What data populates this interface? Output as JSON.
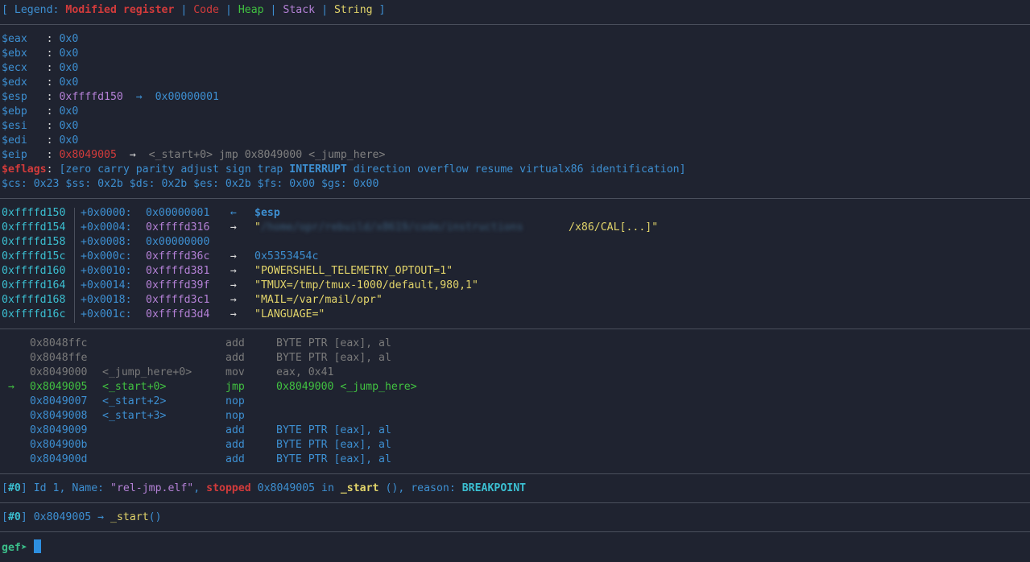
{
  "legend": {
    "open": "[ ",
    "label": "Legend: ",
    "modified": "Modified register",
    "sep": " | ",
    "code": "Code",
    "heap": "Heap",
    "stack": "Stack",
    "string": "String",
    "close": " ]"
  },
  "registers": [
    {
      "name": "$eax",
      "sep": "   : ",
      "value": "0x0"
    },
    {
      "name": "$ebx",
      "sep": "   : ",
      "value": "0x0"
    },
    {
      "name": "$ecx",
      "sep": "   : ",
      "value": "0x0"
    },
    {
      "name": "$edx",
      "sep": "   : ",
      "value": "0x0"
    }
  ],
  "esp": {
    "name": "$esp",
    "sep": "   : ",
    "value": "0xffffd150",
    "arrow": "  →  ",
    "deref": "0x00000001"
  },
  "registers2": [
    {
      "name": "$ebp",
      "sep": "   : ",
      "value": "0x0"
    },
    {
      "name": "$esi",
      "sep": "   : ",
      "value": "0x0"
    },
    {
      "name": "$edi",
      "sep": "   : ",
      "value": "0x0"
    }
  ],
  "eip": {
    "name": "$eip",
    "sep": "   : ",
    "value": "0x8049005",
    "arrow": "  →  ",
    "deref": "<_start+0> jmp 0x8049000 <_jump_here>"
  },
  "eflags": {
    "name": "$eflags",
    "colon": ": ",
    "pre": "[zero carry parity adjust sign trap ",
    "bold": "INTERRUPT",
    "post": " direction overflow resume virtualx86 identification]"
  },
  "segments": "$cs: 0x23 $ss: 0x2b $ds: 0x2b $es: 0x2b $fs: 0x00 $gs: 0x00",
  "stack": [
    {
      "addr": "0xffffd150",
      "offset": "+0x0000: ",
      "value": "0x00000001",
      "arrow": "  ← ",
      "note": "$esp"
    },
    {
      "addr": "0xffffd154",
      "offset": "+0x0004: ",
      "value": "0xffffd316",
      "arrow": "  →  ",
      "str_open": "\"",
      "str_blur": "/home/opr/rebuild/x8619/code/instructions",
      "str_tail": "/x86/CAL[...]\""
    },
    {
      "addr": "0xffffd158",
      "offset": "+0x0008: ",
      "value": "0x00000000"
    },
    {
      "addr": "0xffffd15c",
      "offset": "+0x000c: ",
      "value": "0xffffd36c",
      "arrow": "  →  ",
      "plain": "0x5353454c"
    },
    {
      "addr": "0xffffd160",
      "offset": "+0x0010: ",
      "value": "0xffffd381",
      "arrow": "  →  ",
      "str": "\"POWERSHELL_TELEMETRY_OPTOUT=1\""
    },
    {
      "addr": "0xffffd164",
      "offset": "+0x0014: ",
      "value": "0xffffd39f",
      "arrow": "  →  ",
      "str": "\"TMUX=/tmp/tmux-1000/default,980,1\""
    },
    {
      "addr": "0xffffd168",
      "offset": "+0x0018: ",
      "value": "0xffffd3c1",
      "arrow": "  →  ",
      "str": "\"MAIL=/var/mail/opr\""
    },
    {
      "addr": "0xffffd16c",
      "offset": "+0x001c: ",
      "value": "0xffffd3d4",
      "arrow": "  →  ",
      "str": "\"LANGUAGE=\""
    }
  ],
  "code": [
    {
      "mark": "",
      "addr": "0x8048ffc",
      "sym": "",
      "mnem": "add",
      "ops": "BYTE PTR [eax], al",
      "state": "past"
    },
    {
      "mark": "",
      "addr": "0x8048ffe",
      "sym": "",
      "mnem": "add",
      "ops": "BYTE PTR [eax], al",
      "state": "past"
    },
    {
      "mark": "",
      "addr": "0x8049000",
      "sym": "<_jump_here+0>",
      "mnem": "mov",
      "ops": "eax, 0x41",
      "state": "past"
    },
    {
      "mark": "→",
      "addr": "0x8049005",
      "sym": "<_start+0>",
      "mnem": "jmp",
      "ops": "0x8049000 <_jump_here>",
      "state": "current"
    },
    {
      "mark": "",
      "addr": "0x8049007",
      "sym": "<_start+2>",
      "mnem": "nop",
      "ops": "",
      "state": "future"
    },
    {
      "mark": "",
      "addr": "0x8049008",
      "sym": "<_start+3>",
      "mnem": "nop",
      "ops": "",
      "state": "future"
    },
    {
      "mark": "",
      "addr": "0x8049009",
      "sym": "",
      "mnem": "add",
      "ops": "BYTE PTR [eax], al",
      "state": "future"
    },
    {
      "mark": "",
      "addr": "0x804900b",
      "sym": "",
      "mnem": "add",
      "ops": "BYTE PTR [eax], al",
      "state": "future"
    },
    {
      "mark": "",
      "addr": "0x804900d",
      "sym": "",
      "mnem": "add",
      "ops": "BYTE PTR [eax], al",
      "state": "future"
    }
  ],
  "thread": {
    "open": "[",
    "id": "#0",
    "close": "]",
    "text1": " Id 1, Name: ",
    "name": "\"rel-jmp.elf\"",
    "comma": ", ",
    "state": "stopped",
    "text2": " 0x8049005 in ",
    "func": "_start",
    "text3": " (), reason: ",
    "reason": "BREAKPOINT"
  },
  "trace": {
    "open": "[",
    "id": "#0",
    "close": "]",
    "text1": " 0x8049005 → ",
    "func": "_start",
    "parens": "()"
  },
  "prompt": {
    "label": "gef➤ ",
    "input": ""
  }
}
